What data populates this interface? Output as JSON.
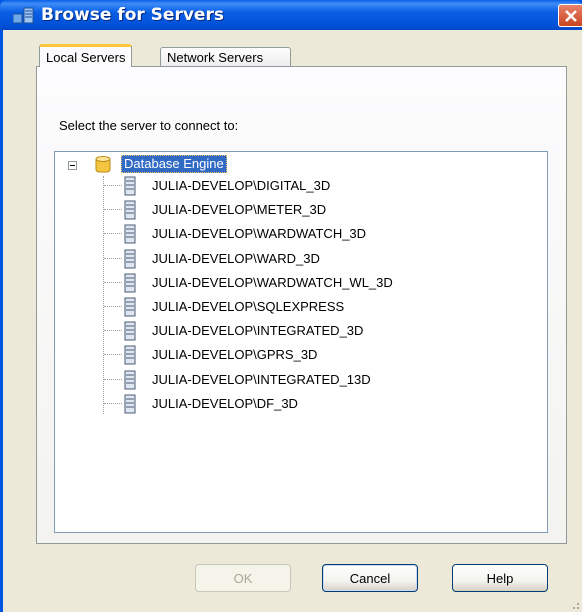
{
  "window": {
    "title": "Browse for Servers",
    "icon": "server-browse-icon",
    "accent": "#0054e3"
  },
  "tabs": [
    {
      "label": "Local Servers",
      "selected": true
    },
    {
      "label": "Network Servers",
      "selected": false
    }
  ],
  "prompt": "Select the server to connect to:",
  "tree": {
    "root": {
      "label": "Database Engine",
      "expanded": true,
      "icon": "database-icon"
    },
    "items": [
      "JULIA-DEVELOP\\DIGITAL_3D",
      "JULIA-DEVELOP\\METER_3D",
      "JULIA-DEVELOP\\WARDWATCH_3D",
      "JULIA-DEVELOP\\WARD_3D",
      "JULIA-DEVELOP\\WARDWATCH_WL_3D",
      "JULIA-DEVELOP\\SQLEXPRESS",
      "JULIA-DEVELOP\\INTEGRATED_3D",
      "JULIA-DEVELOP\\GPRS_3D",
      "JULIA-DEVELOP\\INTEGRATED_13D",
      "JULIA-DEVELOP\\DF_3D"
    ]
  },
  "buttons": {
    "ok": "OK",
    "cancel": "Cancel",
    "help": "Help"
  }
}
